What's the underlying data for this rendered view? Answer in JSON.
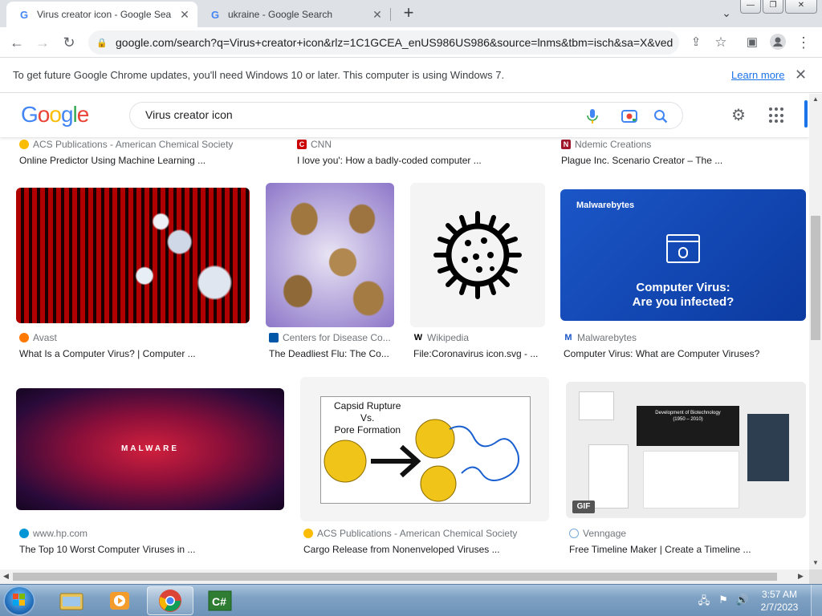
{
  "browser": {
    "tabs": [
      {
        "title": "Virus creator icon - Google Searc",
        "favicon": "google-g-icon",
        "active": true
      },
      {
        "title": "ukraine - Google Search",
        "favicon": "google-g-icon",
        "active": false
      }
    ],
    "new_tab_label": "+",
    "url": "google.com/search?q=Virus+creator+icon&rlz=1C1GCEA_enUS986US986&source=lnms&tbm=isch&sa=X&ved...",
    "infobar": {
      "message": "To get future Google Chrome updates, you'll need Windows 10 or later. This computer is using Windows 7.",
      "link": "Learn more"
    }
  },
  "google": {
    "logo": "Google",
    "query": "Virus creator icon",
    "colors": {
      "blue": "#4285f4",
      "red": "#ea4335",
      "yellow": "#fbbc05",
      "green": "#34a853"
    }
  },
  "results": {
    "row0": [
      {
        "source": "ACS Publications - American Chemical Society",
        "caption": "Online Predictor Using Machine Learning ..."
      },
      {
        "source": "CNN",
        "caption": "I love you': How a badly-coded computer ..."
      },
      {
        "source": "Ndemic Creations",
        "caption": "Plague Inc. Scenario Creator – The ..."
      }
    ],
    "row1": [
      {
        "source": "Avast",
        "caption": "What Is a Computer Virus? | Computer ..."
      },
      {
        "source": "Centers for Disease Co...",
        "caption": "The Deadliest Flu: The Co..."
      },
      {
        "source": "Wikipedia",
        "caption": "File:Coronavirus icon.svg - ..."
      },
      {
        "source": "Malwarebytes",
        "caption": "Computer Virus: What are Computer Viruses?",
        "image_brand": "Malwarebytes",
        "image_text_1": "Computer Virus:",
        "image_text_2": "Are you infected?"
      }
    ],
    "row2": [
      {
        "source": "www.hp.com",
        "caption": "The Top 10 Worst Computer Viruses in ...",
        "image_text": "MALWARE"
      },
      {
        "source": "ACS Publications - American Chemical Society",
        "caption": "Cargo Release from Nonenveloped Viruses ...",
        "image_text_1": "Capsid Rupture",
        "image_text_2": "Vs.",
        "image_text_3": "Pore Formation"
      },
      {
        "source": "Venngage",
        "caption": "Free Timeline Maker | Create a Timeline ...",
        "badge": "GIF",
        "image_title": "Development of Biotechnology",
        "image_subtitle": "(1950 – 2010)"
      }
    ]
  },
  "taskbar": {
    "time": "3:57 AM",
    "date": "2/7/2023",
    "apps": [
      "explorer",
      "media-player",
      "chrome",
      "csharp-editor"
    ]
  }
}
